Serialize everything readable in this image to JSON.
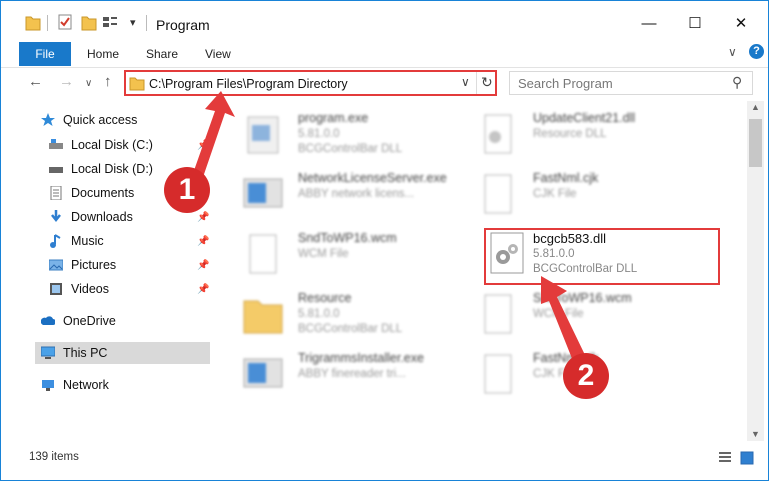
{
  "window": {
    "title": "Program",
    "minimize": "—",
    "maximize": "☐",
    "close": "✕"
  },
  "ribbon": {
    "file": "File",
    "home": "Home",
    "share": "Share",
    "view": "View"
  },
  "nav": {
    "back": "←",
    "forward": "→",
    "dropdown": "∨",
    "up": "↑",
    "address": "C:\\Program Files\\Program Directory",
    "address_dropdown": "∨",
    "refresh": "↻",
    "search_placeholder": "Search Program",
    "search_icon": "⚲"
  },
  "sidebar": {
    "items": [
      {
        "label": "Quick access",
        "icon": "star-icon"
      },
      {
        "label": "Local Disk (C:)",
        "icon": "drive-icon"
      },
      {
        "label": "Local Disk (D:)",
        "icon": "drive-icon"
      },
      {
        "label": "Documents",
        "icon": "document-icon"
      },
      {
        "label": "Downloads",
        "icon": "download-icon"
      },
      {
        "label": "Music",
        "icon": "music-icon"
      },
      {
        "label": "Pictures",
        "icon": "pictures-icon"
      },
      {
        "label": "Videos",
        "icon": "videos-icon"
      },
      {
        "label": "OneDrive",
        "icon": "cloud-icon"
      },
      {
        "label": "This PC",
        "icon": "computer-icon"
      },
      {
        "label": "Network",
        "icon": "network-icon"
      }
    ]
  },
  "files": [
    {
      "name": "program.exe",
      "line2": "5.81.0.0",
      "line3": "BCGControlBar DLL"
    },
    {
      "name": "UpdateClient21.dll",
      "line2": "Resource DLL",
      "line3": ""
    },
    {
      "name": "NetworkLicenseServer.exe",
      "line2": "ABBY network licens...",
      "line3": ""
    },
    {
      "name": "FastNml.cjk",
      "line2": "CJK File",
      "line3": ""
    },
    {
      "name": "SndToWP16.wcm",
      "line2": "WCM File",
      "line3": ""
    },
    {
      "name": "bcgcb583.dll",
      "line2": "5.81.0.0",
      "line3": "BCGControlBar DLL"
    },
    {
      "name": "Resource",
      "line2": "5.81.0.0",
      "line3": "BCGControlBar DLL"
    },
    {
      "name": "SndToWP16.wcm",
      "line2": "WCM File",
      "line3": ""
    },
    {
      "name": "TrigrammsInstaller.exe",
      "line2": "ABBY finereader tri...",
      "line3": ""
    },
    {
      "name": "FastNml.cjk",
      "line2": "CJK File",
      "line3": ""
    }
  ],
  "status": {
    "count": "139 items"
  },
  "callouts": [
    "1",
    "2"
  ],
  "colors": {
    "accent": "#1979ca",
    "highlight": "#e33b3b",
    "callout": "#d62b2b"
  }
}
